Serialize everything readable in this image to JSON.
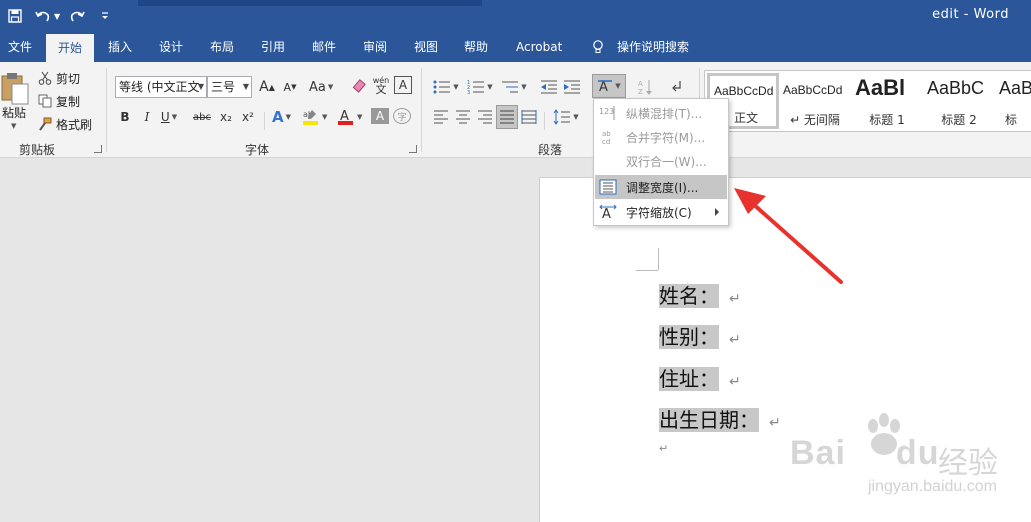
{
  "window": {
    "title": "edit  -  Word"
  },
  "tabs": [
    "文件",
    "开始",
    "插入",
    "设计",
    "布局",
    "引用",
    "邮件",
    "审阅",
    "视图",
    "帮助",
    "Acrobat",
    "操作说明搜索"
  ],
  "active_tab": "开始",
  "clipboard": {
    "paste": "粘贴",
    "cut": "剪切",
    "copy": "复制",
    "format_painter": "格式刷",
    "group": "剪贴板"
  },
  "font": {
    "name": "等线 (中文正文",
    "size": "三号",
    "group": "字体",
    "aa": "Aa",
    "pinyin": "wén",
    "bold": "B",
    "italic": "I",
    "underline": "U",
    "strike": "abc",
    "sub": "x₂",
    "sup": "x²",
    "char_border": "A",
    "char_shade": "A",
    "enclosed": "字"
  },
  "paragraph": {
    "group": "段落"
  },
  "styles": [
    {
      "preview": "AaBbCcDd",
      "name": "正文"
    },
    {
      "preview": "AaBbCcDd",
      "name": "↵ 无间隔"
    },
    {
      "preview": "AaBl",
      "name": "标题 1"
    },
    {
      "preview": "AaBbC",
      "name": "标题 2"
    },
    {
      "preview": "AaB",
      "name": "标"
    }
  ],
  "menu": [
    {
      "label": "纵横混排(T)...",
      "state": "disabled",
      "icon": "vertical-horizontal-icon"
    },
    {
      "label": "合并字符(M)...",
      "state": "disabled",
      "icon": "combine-chars-icon"
    },
    {
      "label": "双行合一(W)...",
      "state": "disabled",
      "icon": "two-lines-icon"
    },
    {
      "label": "调整宽度(I)...",
      "state": "hover",
      "icon": "fit-text-icon"
    },
    {
      "label": "字符缩放(C)",
      "state": "normal",
      "icon": "char-scale-icon"
    }
  ],
  "document": {
    "lines": [
      "姓名：",
      "性别：",
      "住址：",
      "出生日期："
    ],
    "para_mark": "↵"
  },
  "watermark": {
    "logo": "Bai",
    "logo2": "du",
    "cn": "经验",
    "url": "jingyan.baidu.com"
  },
  "colors": {
    "word_blue": "#2b579a",
    "ribbon_bg": "#f3f3f3",
    "highlight": "#c8c8c8",
    "arrow_red": "#e8322d"
  }
}
